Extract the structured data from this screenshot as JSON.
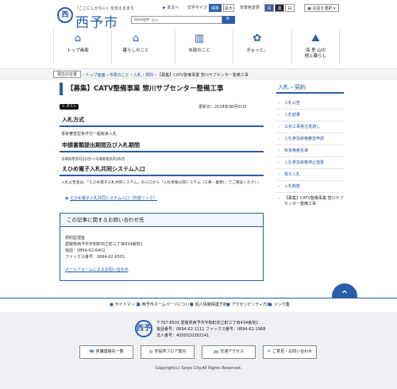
{
  "header": {
    "logo_mark": "西",
    "tagline": "「ここにしかない」を伝えるまち",
    "site_name": "西予市",
    "search_brand": "Google",
    "search_hint": "提供",
    "search_icon_glyph": "🔍",
    "text_only": "本文へ",
    "font_size_label": "文字サイズ",
    "font_standard": "標準",
    "font_large": "拡大",
    "bg_color_label": "背景色変更",
    "bg_white": "白",
    "bg_black": "黒",
    "bg_blue": "青",
    "language_label": "言語を選択"
  },
  "nav": {
    "items": [
      {
        "label": "トップ画面",
        "icon": "home-icon",
        "glyph": "⌂"
      },
      {
        "label": "暮らしのこと",
        "icon": "house-icon",
        "glyph": "⌂"
      },
      {
        "label": "市政のこと",
        "icon": "building-icon",
        "glyph": "▥"
      },
      {
        "label": "ぎゅっと。",
        "icon": "balloon-icon",
        "glyph": "✿"
      },
      {
        "label": "海 里 山の\n極上暮らし",
        "icon": "mountain-icon",
        "glyph": "⛰"
      }
    ]
  },
  "breadcrumb": {
    "badge": "現在の位置",
    "items": [
      "トップ画面",
      "市政のこと",
      "入札・契約",
      "【募集】CATV整備事業 惣川サブセンター整備工事"
    ]
  },
  "main": {
    "title": "【募集】CATV整備事業 惣川サブセンター整備工事",
    "post_label": "ポスト",
    "updated": "更新日：2024年08月01日",
    "sections": [
      {
        "heading": "入札方式",
        "text": "事後審査型条件付一般競争入札"
      },
      {
        "heading": "申請書類提出期間及び入札期間",
        "text": "令和6年8月22日～令和6年8月26日"
      },
      {
        "heading": "えひめ電子入札共同システム入口",
        "text": "入札公告等は、「えひめ電子入札共同システム」の入口から「入札情報公開システム（工事・業務）」でご確認ください。",
        "link": "えひめ電子入札共同システム入口（外部リンク）"
      }
    ],
    "inquiry": {
      "heading": "この記事に関するお問い合わせ先",
      "lines": [
        "契約監理室",
        "愛媛県西予市宇和町卯之町三丁目434番地1",
        "電話：0894-62-6402",
        "ファックス番号：0894-62-6501"
      ],
      "form_link": "メールフォームによるお問い合わせ"
    }
  },
  "sidebar": {
    "title": "入札・契約",
    "items": [
      "入札公告",
      "入札結果",
      "公共工事発注見通し",
      "入札参加資格審査申請",
      "有資格者名簿",
      "入札参加資格停止措置",
      "電子入札",
      "入札制度",
      "【募集】CATV整備事業 惣川サブセンター整備工事"
    ]
  },
  "footer": {
    "links": [
      "サイトマップ",
      "西予市ホームページについて",
      "個人情報保護方針",
      "アクセシビリティ方針",
      "リンク集"
    ],
    "logo_mark": "西予",
    "address": "〒797-8501 愛媛県西予市宇和町卯之町三丁目434番地1",
    "phone": "電話番号：0894-62-1111 ファックス番号：0894-62-1968",
    "corp_no": "法人番号：4000020382141",
    "buttons": [
      {
        "label": "各課連絡先一覧",
        "icon": "phone-icon",
        "glyph": "☎"
      },
      {
        "label": "市役所フロア案内",
        "icon": "floor-map-icon",
        "glyph": "▤"
      },
      {
        "label": "交通アクセス",
        "icon": "bus-icon",
        "glyph": "🚌"
      },
      {
        "label": "ご意見・お問い合わせ",
        "icon": "mail-icon",
        "glyph": "✉"
      }
    ],
    "copyright": "Copyright(c) Seiyo City.All Rights Reserved."
  },
  "pagetop_glyph": "⌃",
  "colors": {
    "accent": "#2a5ea8",
    "link": "#1a56a8"
  }
}
